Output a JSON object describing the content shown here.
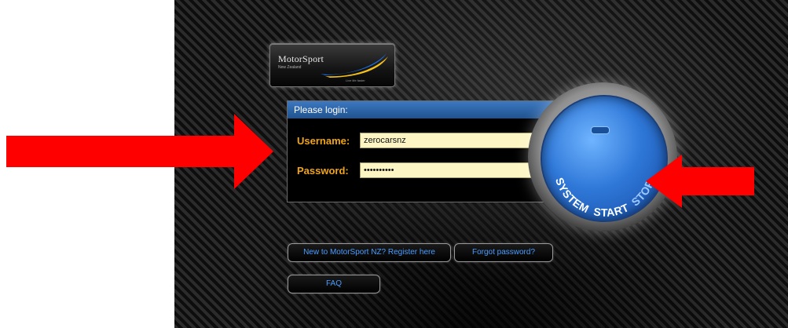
{
  "logo": {
    "title": "MotorSport",
    "subtitle": "New Zealand",
    "tagline": "Live life faster"
  },
  "login": {
    "header": "Please login:",
    "username_label": "Username:",
    "username_value": "zerocarsnz",
    "password_label": "Password:",
    "password_value": "••••••••••"
  },
  "buttons": {
    "register": "New to MotorSport NZ? Register here",
    "forgot": "Forgot password?",
    "faq": "FAQ"
  },
  "start_button": {
    "label_system": "SYSTEM",
    "label_start": "START",
    "label_stop": "STOP"
  },
  "colors": {
    "accent_blue": "#2f78d8",
    "label_orange": "#f0a515",
    "arrow_red": "#ff0000",
    "input_bg": "#fdf6c4"
  }
}
